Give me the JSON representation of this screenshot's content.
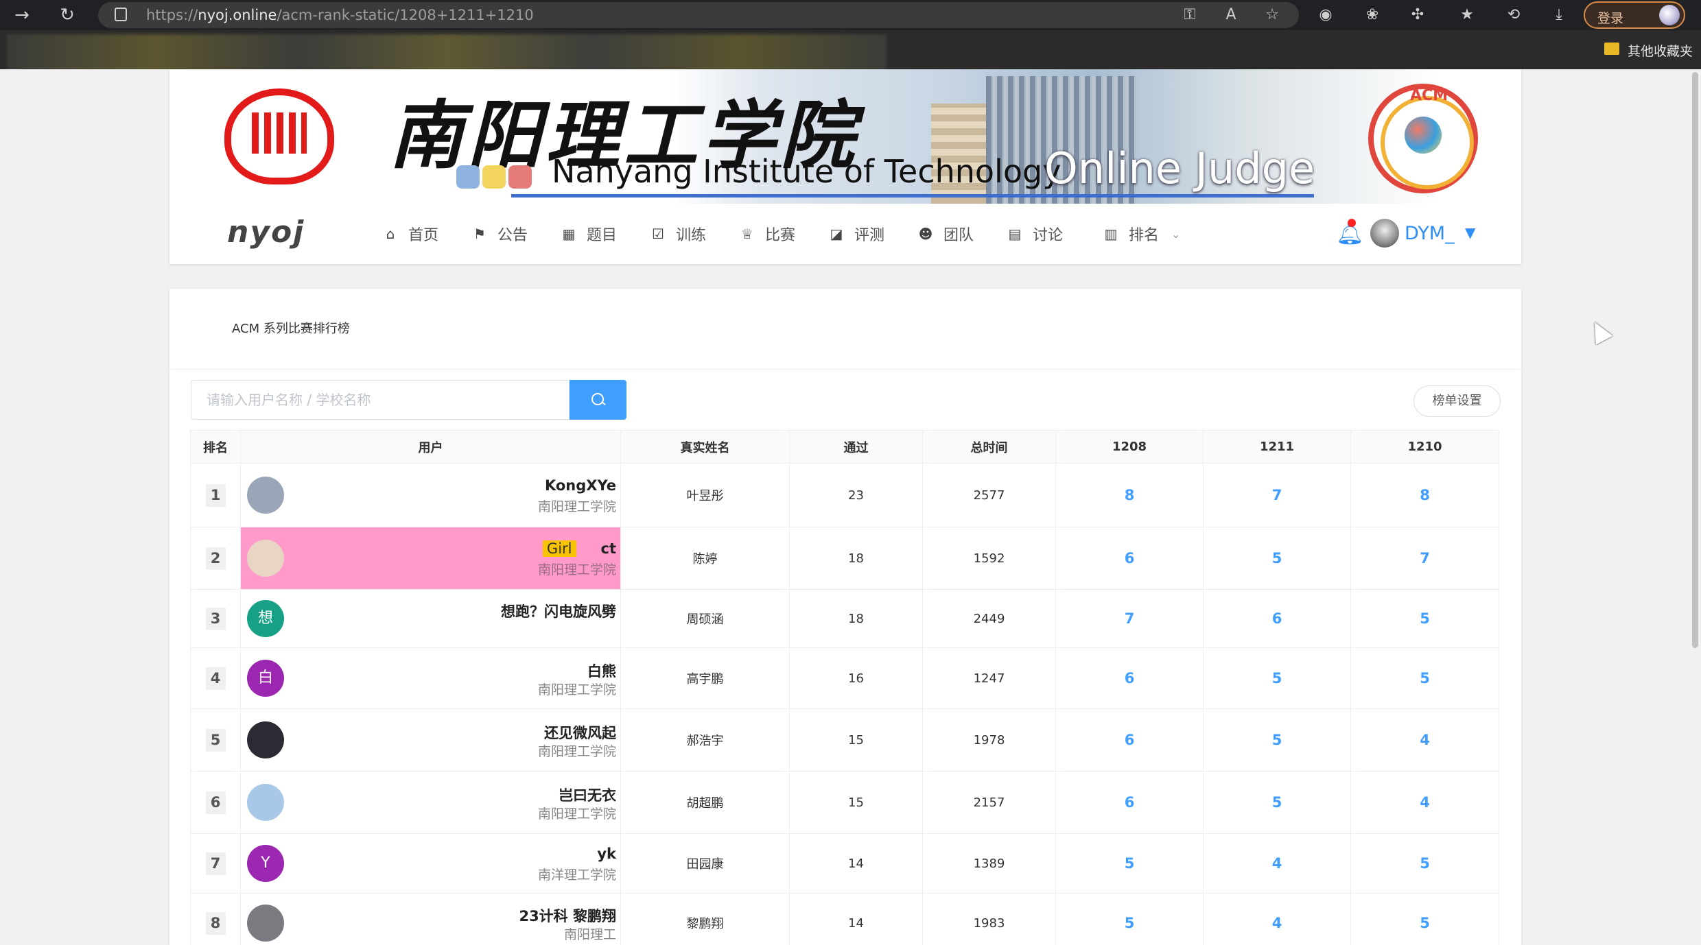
{
  "browser": {
    "url_prefix": "https://",
    "url_host": "nyoj.online",
    "url_path": "/acm-rank-static/1208+1211+1210",
    "login_label": "登录",
    "bookmark_folder": "其他收藏夹",
    "toolbar_icons": [
      "back-icon",
      "refresh-icon",
      "lock-icon",
      "key-icon",
      "read-aloud-icon",
      "star-icon",
      "extension-icon",
      "favorites-icon",
      "history-icon",
      "download-icon"
    ]
  },
  "banner": {
    "cn_title": "南阳理工学院",
    "en_title": "Nanyang Institute of Technology",
    "oj_title": "Online Judge",
    "acm_label": "ACM"
  },
  "nav": {
    "brand": "nyoj",
    "items": [
      {
        "label": "首页",
        "icon": "home-icon"
      },
      {
        "label": "公告",
        "icon": "flag-icon"
      },
      {
        "label": "题目",
        "icon": "grid-icon"
      },
      {
        "label": "训练",
        "icon": "clipboard-check-icon"
      },
      {
        "label": "比赛",
        "icon": "trophy-icon"
      },
      {
        "label": "评测",
        "icon": "chart-line-icon"
      },
      {
        "label": "团队",
        "icon": "users-icon"
      },
      {
        "label": "讨论",
        "icon": "comment-icon"
      },
      {
        "label": "排名",
        "icon": "bar-chart-icon"
      }
    ],
    "user": "DYM_"
  },
  "main": {
    "title": "ACM 系列比赛排行榜",
    "search_placeholder": "请输入用户名称 / 学校名称",
    "settings_label": "榜单设置",
    "columns": [
      "排名",
      "用户",
      "真实姓名",
      "通过",
      "总时间",
      "1208",
      "1211",
      "1210"
    ],
    "rows": [
      {
        "rank": "1",
        "name": "KongXYe",
        "school": "南阳理工学院",
        "real": "叶昱彤",
        "solved": "23",
        "time": "2577",
        "p1": "8",
        "p2": "7",
        "p3": "8",
        "avatar_text": "",
        "avatar_color": "#9aa6b8",
        "tag": "",
        "highlight": false
      },
      {
        "rank": "2",
        "name": "ct",
        "school": "南阳理工学院",
        "real": "陈婷",
        "solved": "18",
        "time": "1592",
        "p1": "6",
        "p2": "5",
        "p3": "7",
        "avatar_text": "",
        "avatar_color": "#e8d5c4",
        "tag": "Girl",
        "highlight": true
      },
      {
        "rank": "3",
        "name": "想跑？闪电旋风劈",
        "school": "",
        "real": "周硕涵",
        "solved": "18",
        "time": "2449",
        "p1": "7",
        "p2": "6",
        "p3": "5",
        "avatar_text": "想",
        "avatar_color": "#16a085",
        "tag": "",
        "highlight": false
      },
      {
        "rank": "4",
        "name": "白熊",
        "school": "南阳理工学院",
        "real": "高宇鹏",
        "solved": "16",
        "time": "1247",
        "p1": "6",
        "p2": "5",
        "p3": "5",
        "avatar_text": "白",
        "avatar_color": "#9c27b0",
        "tag": "",
        "highlight": false
      },
      {
        "rank": "5",
        "name": "还见微风起",
        "school": "南阳理工学院",
        "real": "郝浩宇",
        "solved": "15",
        "time": "1978",
        "p1": "6",
        "p2": "5",
        "p3": "4",
        "avatar_text": "",
        "avatar_color": "#2c2a33",
        "tag": "",
        "highlight": false
      },
      {
        "rank": "6",
        "name": "岂曰无衣",
        "school": "南阳理工学院",
        "real": "胡超鹏",
        "solved": "15",
        "time": "2157",
        "p1": "6",
        "p2": "5",
        "p3": "4",
        "avatar_text": "",
        "avatar_color": "#a9c8e8",
        "tag": "",
        "highlight": false
      },
      {
        "rank": "7",
        "name": "yk",
        "school": "南洋理工学院",
        "real": "田园康",
        "solved": "14",
        "time": "1389",
        "p1": "5",
        "p2": "4",
        "p3": "5",
        "avatar_text": "Y",
        "avatar_color": "#9c27b0",
        "tag": "",
        "highlight": false
      },
      {
        "rank": "8",
        "name": "23计科 黎鹏翔",
        "school": "南阳理工",
        "real": "黎鹏翔",
        "solved": "14",
        "time": "1983",
        "p1": "5",
        "p2": "4",
        "p3": "5",
        "avatar_text": "",
        "avatar_color": "#7a7a80",
        "tag": "",
        "highlight": false
      }
    ]
  },
  "colors": {
    "accent": "#409eff",
    "highlight_row": "#ff9acb",
    "girl_tag": "#f8c300"
  }
}
